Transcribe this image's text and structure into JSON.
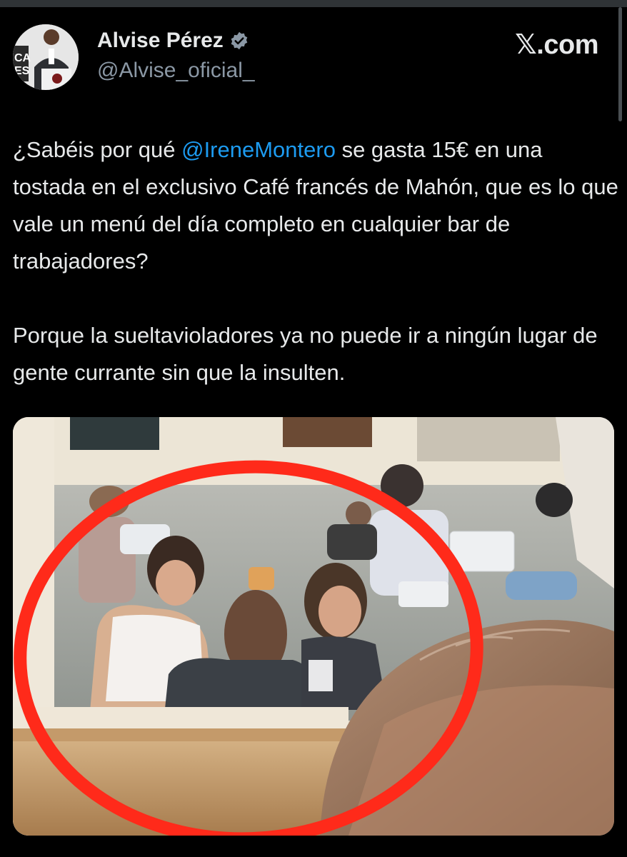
{
  "author": {
    "name": "Alvise Pérez",
    "handle": "@Alvise_oficial_",
    "verified": true
  },
  "brand": {
    "label": ".com",
    "icon": "x-logo-icon"
  },
  "tweet": {
    "p1_before": "¿Sabéis por qué ",
    "mention": "@IreneMontero",
    "p1_after": " se gasta 15€ en una tostada en el exclusivo Café francés de Mahón, que es lo que vale un menú del día completo en cualquier bar de trabajadores?",
    "p2": "Porque la sueltavioladores ya no puede ir a ningún lugar de gente currante sin que la insulten."
  },
  "colors": {
    "background": "#000000",
    "text": "#e7e9ea",
    "muted": "#8b98a5",
    "link": "#1d9bf0",
    "verified": "#8b98a5",
    "highlight_circle": "#ff2a1a"
  }
}
